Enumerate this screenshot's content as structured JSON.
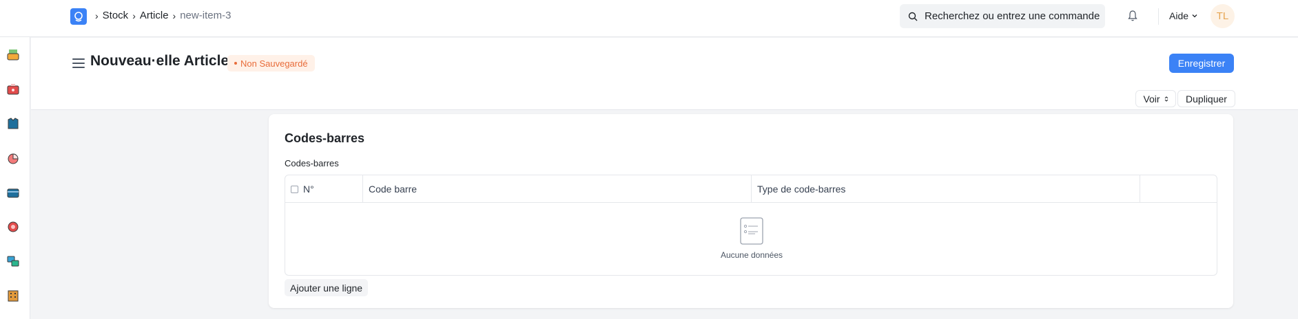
{
  "navbar": {
    "logo_icon": "frappe-logo-icon",
    "breadcrumbs": [
      "Stock",
      "Article",
      "new-item-3"
    ],
    "search_placeholder": "Recherchez ou entrez une commande",
    "help_label": "Aide",
    "avatar_initials": "TL"
  },
  "sidebar": {
    "icons": [
      "basket-icon",
      "toolbox-icon",
      "shirt-icon",
      "pie-chart-icon",
      "wallet-icon",
      "support-icon",
      "shapes-icon",
      "building-icon"
    ]
  },
  "page": {
    "title": "Nouveau·elle Article",
    "status_badge": "Non Sauvegardé",
    "save_label": "Enregistrer",
    "view_label": "Voir",
    "duplicate_label": "Dupliquer"
  },
  "section": {
    "title": "Codes-barres",
    "field_label": "Codes-barres",
    "table": {
      "columns": [
        "N°",
        "Code barre",
        "Type de code-barres"
      ],
      "rows": [],
      "empty_text": "Aucune données"
    },
    "add_row_label": "Ajouter une ligne"
  },
  "colors": {
    "primary": "#3b82f6",
    "badge_text": "#e86c3a",
    "badge_bg": "#fff1e8",
    "avatar_bg": "#fdf2e6",
    "avatar_text": "#e7a552"
  }
}
